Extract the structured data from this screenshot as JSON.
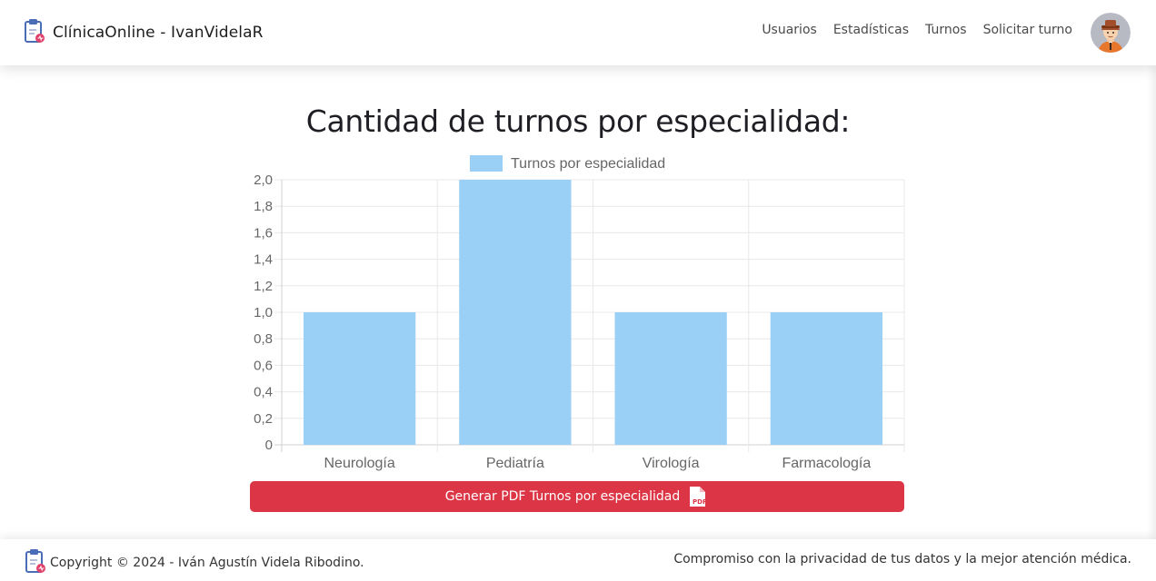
{
  "navbar": {
    "brand": "ClínicaOnline - IvanVidelaR",
    "links": [
      "Usuarios",
      "Estadísticas",
      "Turnos",
      "Solicitar turno"
    ]
  },
  "main": {
    "title": "Cantidad de turnos por especialidad:",
    "pdf_button": "Generar PDF Turnos por especialidad",
    "pdf_icon_text": "PDF"
  },
  "chart_data": {
    "type": "bar",
    "categories": [
      "Neurología",
      "Pediatría",
      "Virología",
      "Farmacología"
    ],
    "series": [
      {
        "name": "Turnos por especialidad",
        "values": [
          1,
          2,
          1,
          1
        ]
      }
    ],
    "ylim": [
      0,
      2
    ],
    "yticks": [
      "0",
      "0,2",
      "0,4",
      "0,6",
      "0,8",
      "1,0",
      "1,2",
      "1,4",
      "1,6",
      "1,8",
      "2,0"
    ],
    "legend": "top",
    "grid": true,
    "bar_color": "#9ad0f5"
  },
  "footer": {
    "copyright": "Copyright © 2024 - Iván Agustín Videla Ribodino.",
    "tagline": "Compromiso con la privacidad de tus datos y la mejor atención médica."
  },
  "colors": {
    "danger": "#dc3545",
    "bar": "#9ad0f5"
  }
}
